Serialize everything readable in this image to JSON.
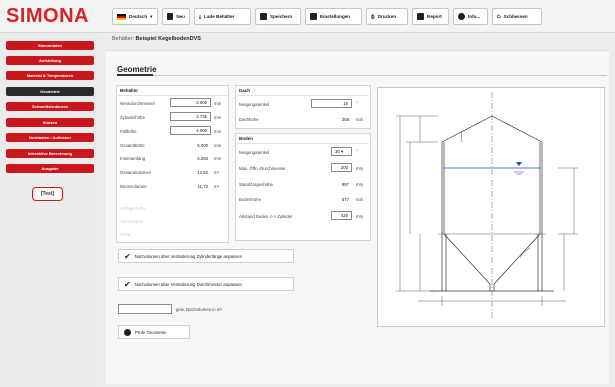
{
  "app": {
    "logo": "SIMONA"
  },
  "toolbar": {
    "language": "Deutsch",
    "new": "Neu",
    "load": "Lade Behälter",
    "save": "Speichern",
    "settings": "Einstellungen",
    "print": "Drucken",
    "report": "Report",
    "info": "Info...",
    "close": "Schliessen"
  },
  "sidebar": {
    "items": [
      {
        "label": "Stammdaten"
      },
      {
        "label": "Aufstellung"
      },
      {
        "label": "Material & Temperaturen"
      },
      {
        "label": "Geometrie"
      },
      {
        "label": "Schweißstrukturen"
      },
      {
        "label": "Stutzen"
      },
      {
        "label": "Nutzlasten / Auflasten"
      },
      {
        "label": "Interaktive Berechnung"
      },
      {
        "label": "Ausgabe"
      }
    ],
    "test_button": "[Test]"
  },
  "breadcrumb": {
    "prefix": "Behälter:",
    "name": "Beispiel KegelbodenDVS"
  },
  "section_title": "Geometrie",
  "behaelter": {
    "title": "Behälter",
    "rows": [
      {
        "label": "Nenndurchmesser",
        "value": "2.000",
        "unit": "mm",
        "editable": true
      },
      {
        "label": "Zylinderhöhe",
        "value": "3.735",
        "unit": "mm",
        "editable": true
      },
      {
        "label": "Füllhöhe",
        "value": "4.000",
        "unit": "mm",
        "editable": true
      },
      {
        "label": "Gesamthöhe",
        "value": "5.000",
        "unit": "mm",
        "editable": false
      },
      {
        "label": "Innenumfang",
        "value": "6.283",
        "unit": "mm",
        "editable": false
      },
      {
        "label": "Gesamtvolumen",
        "value": "12,62",
        "unit": "m³",
        "editable": false
      },
      {
        "label": "Nennvolumen",
        "value": "11,72",
        "unit": "m³",
        "editable": false
      }
    ],
    "ghost_rows": [
      "Auflagerhöhe",
      "Trennebene",
      "Höhe"
    ]
  },
  "dach": {
    "title": "Dach",
    "rows": [
      {
        "label": "Neigungswinkel",
        "value": "15",
        "unit": "°",
        "editable": true
      },
      {
        "label": "Dachhöhe",
        "value": "268",
        "unit": "mm",
        "editable": false
      }
    ]
  },
  "boden": {
    "title": "Boden",
    "rows": [
      {
        "label": "Neigungswinkel",
        "value": "30",
        "unit": "°",
        "editable": true,
        "select": true
      },
      {
        "label": "Max. Öffn.-Durchmesser",
        "value": "200",
        "unit": "mm",
        "editable": true
      },
      {
        "label": "Standzargenhöhe",
        "value": "997",
        "unit": "mm",
        "editable": false
      },
      {
        "label": "Bodenhöhe",
        "value": "577",
        "unit": "mm",
        "editable": false
      },
      {
        "label": "Abstand Boden <-> Zylinder",
        "value": "420",
        "unit": "mm",
        "editable": true
      }
    ]
  },
  "actions": {
    "adjust_cylinder": "Nutzvolumen über Veränderung Zylinderlänge anpassen",
    "adjust_diameter": "Nutzvolumen über Veränderung Durchmesser anpassen",
    "target_volume_label": "gew. Nutzvolumen in m³",
    "check_geometry": "Prüfe Geometrie"
  },
  "colors": {
    "accent": "#c8171d",
    "active": "#2a2a2a",
    "liquid": "#1a3fc4"
  }
}
